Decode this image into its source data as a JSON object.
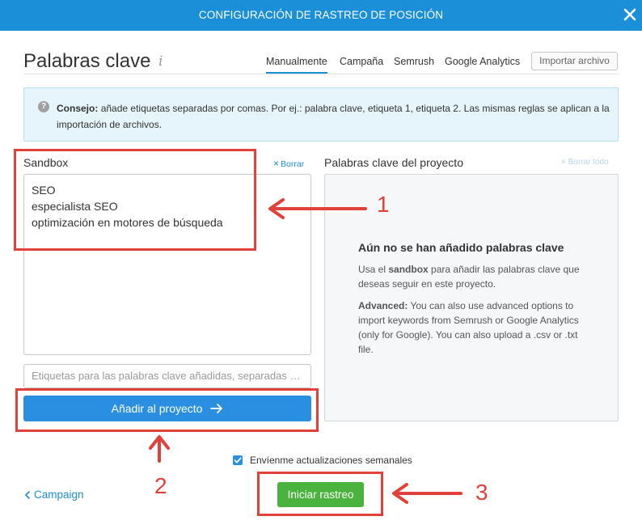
{
  "header": {
    "title": "CONFIGURACIÓN DE RASTREO DE POSICIÓN",
    "close_icon": "close-icon"
  },
  "page": {
    "title": "Palabras clave",
    "info_icon": "info-icon"
  },
  "tabs": [
    {
      "label": "Manualmente",
      "active": true
    },
    {
      "label": "Campaña",
      "active": false
    },
    {
      "label": "Semrush",
      "active": false
    },
    {
      "label": "Google Analytics",
      "active": false
    }
  ],
  "import_button": "Importar archivo",
  "tip": {
    "icon": "question-icon",
    "label": "Consejo:",
    "text": "añade etiquetas separadas por comas. Por ej.: palabra clave, etiqueta 1, etiqueta 2. Las mismas reglas se aplican a la importación de archivos."
  },
  "sandbox": {
    "label": "Sandbox",
    "clear_label": "Borrar",
    "keywords": [
      "SEO",
      "especialista SEO",
      "optimización en motores de búsqueda"
    ],
    "tags_placeholder": "Etiquetas para las palabras clave añadidas, separadas por comas",
    "add_button": "Añadir al proyecto"
  },
  "project": {
    "label": "Palabras clave del proyecto",
    "clear_all_label": "Borrar todo",
    "empty_title": "Aún no se han añadido palabras clave",
    "empty_text_pre": "Usa el ",
    "empty_text_bold": "sandbox",
    "empty_text_post": " para añadir las palabras clave que deseas seguir en este proyecto.",
    "advanced_label": "Advanced:",
    "advanced_text": " You can also use advanced options to import keywords from Semrush or Google Analytics (only for Google). You can also upload a .csv or .txt file."
  },
  "weekly_updates": {
    "label": "Envíenme actualizaciones semanales",
    "checked": true
  },
  "footer": {
    "back_link": "Campaign",
    "start_button": "Iniciar rastreo"
  },
  "annotations": {
    "num1": "1",
    "num2": "2",
    "num3": "3",
    "color": "#e0413a"
  },
  "colors": {
    "header": "#1b8fd8",
    "primary_button": "#2a8fe0",
    "start_button": "#49b33d",
    "tip_background": "#e6f4fb"
  }
}
